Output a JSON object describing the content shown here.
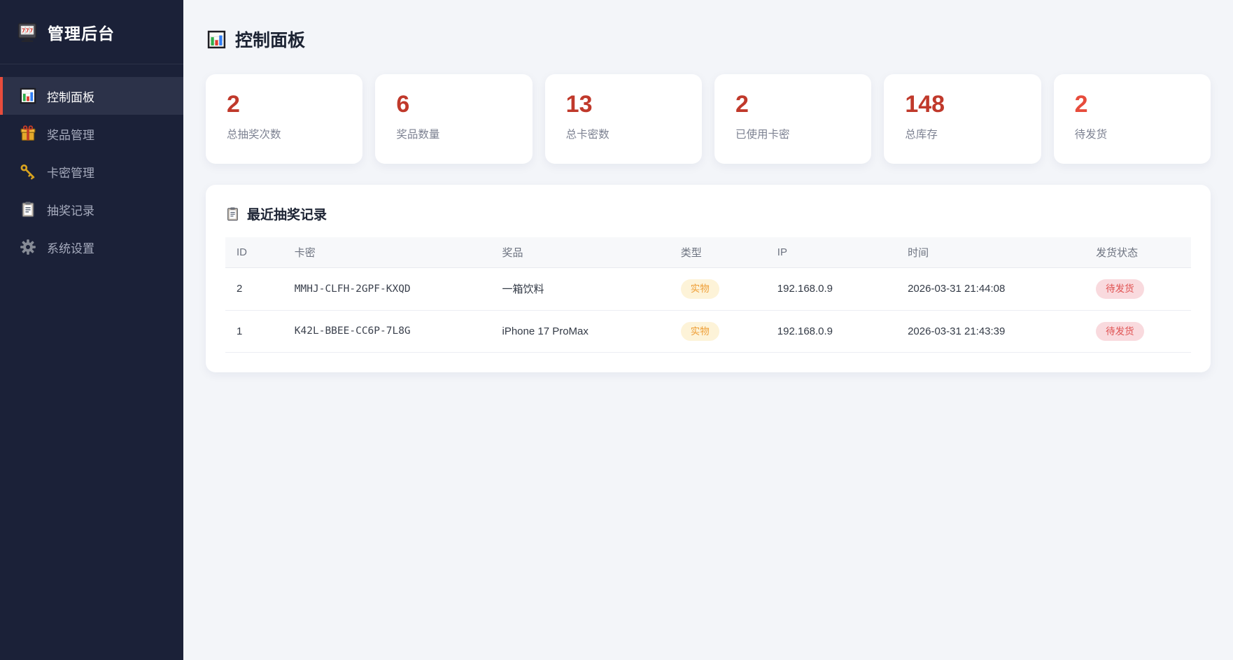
{
  "app": {
    "title": "管理后台"
  },
  "sidebar": {
    "items": [
      {
        "label": "控制面板",
        "icon": "bar-chart-icon",
        "active": true
      },
      {
        "label": "奖品管理",
        "icon": "gift-icon",
        "active": false
      },
      {
        "label": "卡密管理",
        "icon": "key-icon",
        "active": false
      },
      {
        "label": "抽奖记录",
        "icon": "clipboard-icon",
        "active": false
      },
      {
        "label": "系统设置",
        "icon": "gear-icon",
        "active": false
      }
    ]
  },
  "header": {
    "title": "控制面板"
  },
  "stats": [
    {
      "value": "2",
      "label": "总抽奖次数",
      "color": "#c0392b"
    },
    {
      "value": "6",
      "label": "奖品数量",
      "color": "#c0392b"
    },
    {
      "value": "13",
      "label": "总卡密数",
      "color": "#c0392b"
    },
    {
      "value": "2",
      "label": "已使用卡密",
      "color": "#c0392b"
    },
    {
      "value": "148",
      "label": "总库存",
      "color": "#c0392b"
    },
    {
      "value": "2",
      "label": "待发货",
      "color": "#e74c3c"
    }
  ],
  "records": {
    "title": "最近抽奖记录",
    "columns": [
      "ID",
      "卡密",
      "奖品",
      "类型",
      "IP",
      "时间",
      "发货状态"
    ],
    "rows": [
      {
        "id": "2",
        "card_key": "MMHJ-CLFH-2GPF-KXQD",
        "prize": "一箱饮料",
        "type": "实物",
        "ip": "192.168.0.9",
        "time": "2026-03-31 21:44:08",
        "status": "待发货"
      },
      {
        "id": "1",
        "card_key": "K42L-BBEE-CC6P-7L8G",
        "prize": "iPhone 17 ProMax",
        "type": "实物",
        "ip": "192.168.0.9",
        "time": "2026-03-31 21:43:39",
        "status": "待发货"
      }
    ]
  },
  "colors": {
    "sidebar_bg": "#1b2138",
    "active_accent": "#e84c3c",
    "stat_value": "#c0392b",
    "stat_alert": "#e74c3c",
    "type_badge_bg": "#fdf3d8",
    "type_badge_text": "#ee9f38",
    "status_badge_bg": "#f9dade",
    "status_badge_text": "#e05252"
  }
}
